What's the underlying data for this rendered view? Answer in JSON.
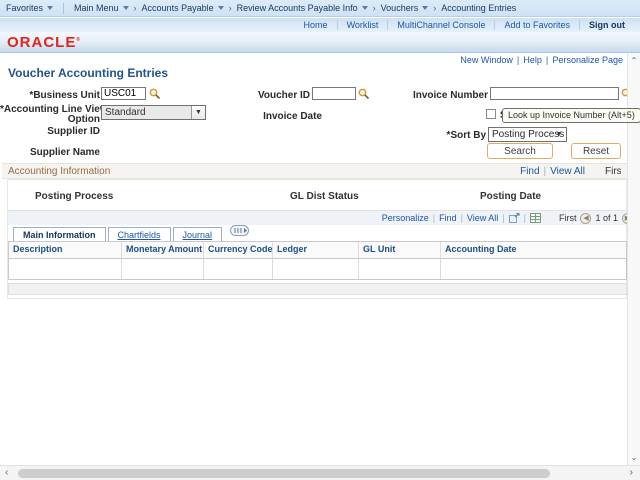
{
  "header": {
    "breadcrumb": {
      "favorites_label": "Favorites",
      "trail": [
        {
          "label": "Main Menu"
        },
        {
          "label": "Accounts Payable"
        },
        {
          "label": "Review Accounts Payable Info"
        },
        {
          "label": "Vouchers"
        },
        {
          "label": "Accounting Entries"
        }
      ]
    },
    "utility_links": [
      {
        "label": "Home"
      },
      {
        "label": "Worklist"
      },
      {
        "label": "MultiChannel Console"
      },
      {
        "label": "Add to Favorites"
      },
      {
        "label": "Sign out"
      }
    ],
    "logo_text": "ORACLE"
  },
  "pagebar": {
    "links": [
      {
        "label": "New Window"
      },
      {
        "label": "Help"
      },
      {
        "label": "Personalize Page"
      }
    ]
  },
  "page_title": "Voucher Accounting Entries",
  "search_form": {
    "business_unit": {
      "label": "*Business Unit",
      "value": "USC01"
    },
    "voucher_id": {
      "label": "Voucher ID",
      "value": ""
    },
    "invoice_number": {
      "label": "Invoice Number",
      "value": ""
    },
    "line_view_label_line1": "*Accounting Line View",
    "line_view_label_line2": "Option",
    "line_view_value": "Standard",
    "invoice_date_label": "Invoice Date",
    "show_checkbox_label": "Show F",
    "supplier_id_label": "Supplier ID",
    "sort_by": {
      "label": "*Sort By",
      "value": "Posting Process"
    },
    "supplier_name_label": "Supplier Name",
    "search_button_label": "Search",
    "reset_button_label": "Reset",
    "lookup_tooltip": "Look up Invoice Number (Alt+5)"
  },
  "accounting_info": {
    "title": "Accounting Information",
    "find_link": "Find",
    "view_all_link": "View All",
    "pager_first": "First",
    "field_labels": [
      "Posting Process",
      "GL Dist Status",
      "Posting Date"
    ],
    "grid": {
      "personalize_link": "Personalize",
      "find_link": "Find",
      "view_all_link": "View All",
      "pager_first": "First",
      "pager_count": "1 of 1",
      "tabs": [
        {
          "label": "Main Information"
        },
        {
          "label": "Chartfields"
        },
        {
          "label": "Journal"
        }
      ],
      "columns": [
        "Description",
        "Monetary Amount",
        "Currency Code",
        "Ledger",
        "GL Unit",
        "Accounting Date"
      ],
      "rows": [
        {
          "description": "",
          "monetary_amount": "",
          "currency_code": "",
          "ledger": "",
          "gl_unit": "",
          "accounting_date": ""
        }
      ]
    }
  },
  "colors": {
    "oracle_red": "#e2231a",
    "link_blue": "#1b57a5",
    "navy_text": "#16355f",
    "section_title_brown": "#996a46",
    "button_border_tan": "#dcab6b"
  }
}
